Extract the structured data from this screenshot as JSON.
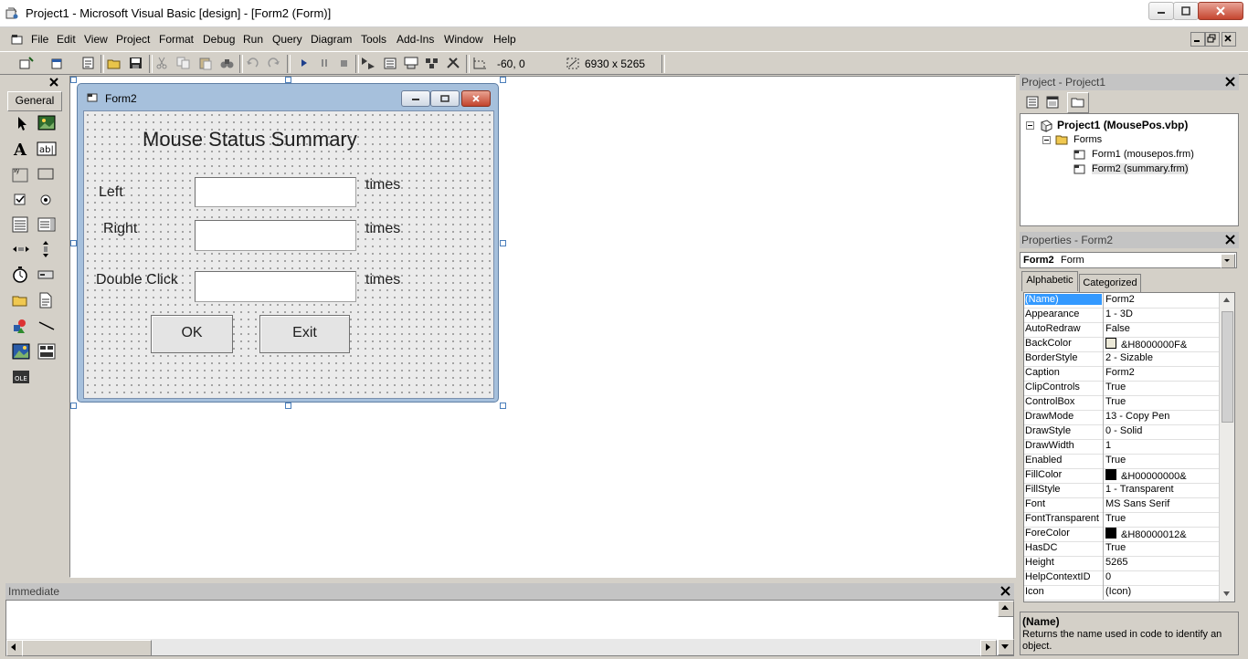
{
  "window": {
    "title": "Project1 - Microsoft Visual Basic [design] - [Form2 (Form)]"
  },
  "menu": [
    "File",
    "Edit",
    "View",
    "Project",
    "Format",
    "Debug",
    "Run",
    "Query",
    "Diagram",
    "Tools",
    "Add-Ins",
    "Window",
    "Help"
  ],
  "toolbar": {
    "position_readout": "-60, 0",
    "size_readout": "6930 x 5265"
  },
  "toolbox": {
    "tab_label": "General",
    "tools": [
      "pointer-icon",
      "picturebox-icon",
      "label-icon",
      "textbox-icon",
      "frame-icon",
      "commandbutton-icon",
      "checkbox-icon",
      "optionbutton-icon",
      "combobox-icon",
      "listbox-icon",
      "hscrollbar-icon",
      "vscrollbar-icon",
      "timer-icon",
      "drivelistbox-icon",
      "dirlistbox-icon",
      "filelistbox-icon",
      "shape-icon",
      "line-icon",
      "image-icon",
      "data-icon",
      "ole-icon"
    ]
  },
  "form": {
    "caption": "Form2",
    "heading": "Mouse Status Summary",
    "rows": [
      {
        "label": "Left",
        "suffix": "times"
      },
      {
        "label": "Right",
        "suffix": "times"
      },
      {
        "label": "Double Click",
        "suffix": "times"
      }
    ],
    "ok_label": "OK",
    "exit_label": "Exit"
  },
  "project": {
    "title": "Project - Project1",
    "root": "Project1 (MousePos.vbp)",
    "folder": "Forms",
    "items": [
      "Form1 (mousepos.frm)",
      "Form2 (summary.frm)"
    ]
  },
  "properties": {
    "title": "Properties - Form2",
    "object_name": "Form2",
    "object_type": "Form",
    "tabs": [
      "Alphabetic",
      "Categorized"
    ],
    "rows": [
      {
        "name": "(Name)",
        "value": "Form2"
      },
      {
        "name": "Appearance",
        "value": "1 - 3D"
      },
      {
        "name": "AutoRedraw",
        "value": "False"
      },
      {
        "name": "BackColor",
        "value": "&H8000000F&",
        "swatch": "#ece9d8"
      },
      {
        "name": "BorderStyle",
        "value": "2 - Sizable"
      },
      {
        "name": "Caption",
        "value": "Form2"
      },
      {
        "name": "ClipControls",
        "value": "True"
      },
      {
        "name": "ControlBox",
        "value": "True"
      },
      {
        "name": "DrawMode",
        "value": "13 - Copy Pen"
      },
      {
        "name": "DrawStyle",
        "value": "0 - Solid"
      },
      {
        "name": "DrawWidth",
        "value": "1"
      },
      {
        "name": "Enabled",
        "value": "True"
      },
      {
        "name": "FillColor",
        "value": "&H00000000&",
        "swatch": "#000000"
      },
      {
        "name": "FillStyle",
        "value": "1 - Transparent"
      },
      {
        "name": "Font",
        "value": "MS Sans Serif"
      },
      {
        "name": "FontTransparent",
        "value": "True"
      },
      {
        "name": "ForeColor",
        "value": "&H80000012&",
        "swatch": "#000000"
      },
      {
        "name": "HasDC",
        "value": "True"
      },
      {
        "name": "Height",
        "value": "5265"
      },
      {
        "name": "HelpContextID",
        "value": "0"
      },
      {
        "name": "Icon",
        "value": "(Icon)"
      }
    ],
    "desc_title": "(Name)",
    "desc_text": "Returns the name used in code to identify an object."
  },
  "immediate": {
    "title": "Immediate"
  }
}
